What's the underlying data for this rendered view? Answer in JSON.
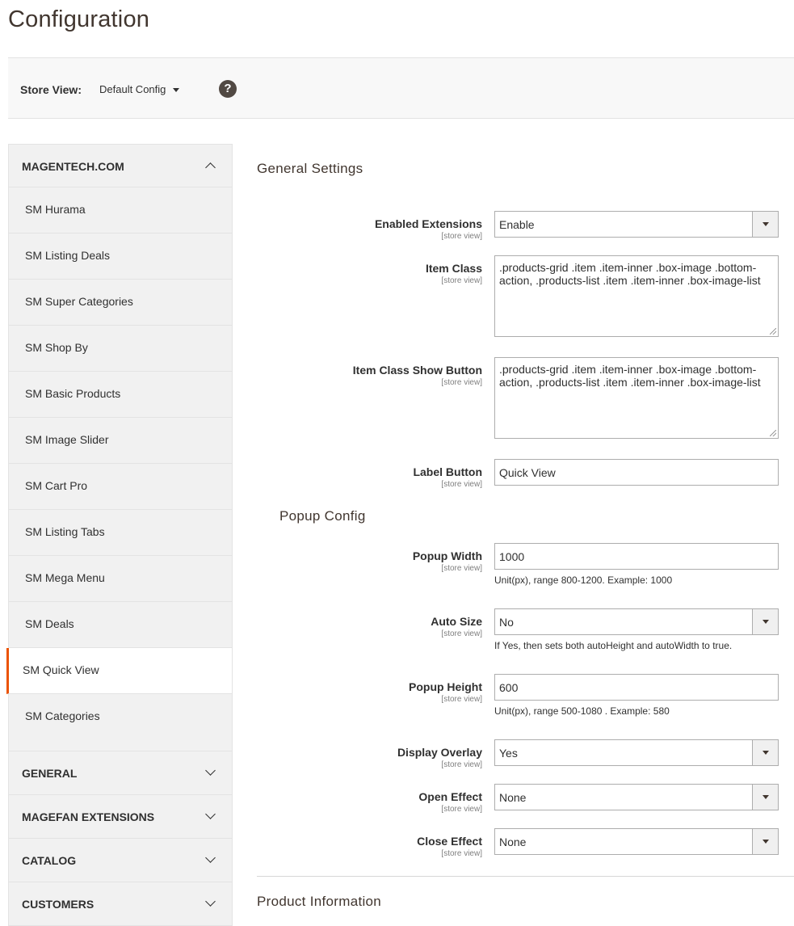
{
  "page_title": "Configuration",
  "store_switcher": {
    "label": "Store View:",
    "value": "Default Config",
    "help": "?"
  },
  "sidebar": {
    "top_section": {
      "title": "MAGENTECH.COM",
      "items": [
        {
          "label": "SM Hurama"
        },
        {
          "label": "SM Listing Deals"
        },
        {
          "label": "SM Super Categories"
        },
        {
          "label": "SM Shop By"
        },
        {
          "label": "SM Basic Products"
        },
        {
          "label": "SM Image Slider"
        },
        {
          "label": "SM Cart Pro"
        },
        {
          "label": "SM Listing Tabs"
        },
        {
          "label": "SM Mega Menu"
        },
        {
          "label": "SM Deals"
        },
        {
          "label": "SM Quick View",
          "active": true
        },
        {
          "label": "SM Categories"
        }
      ]
    },
    "collapsed_sections": [
      {
        "title": "GENERAL"
      },
      {
        "title": "MAGEFAN EXTENSIONS"
      },
      {
        "title": "CATALOG"
      },
      {
        "title": "CUSTOMERS"
      }
    ]
  },
  "main": {
    "general_settings_title": "General Settings",
    "popup_config_title": "Popup Config",
    "product_information_title": "Product Information",
    "scope_label": "[store view]",
    "fields": {
      "enabled_extensions": {
        "label": "Enabled Extensions",
        "value": "Enable"
      },
      "item_class": {
        "label": "Item Class",
        "value": ".products-grid .item .item-inner .box-image .bottom-action, .products-list .item .item-inner .box-image-list"
      },
      "item_class_show_button": {
        "label": "Item Class Show Button",
        "value": ".products-grid .item .item-inner .box-image .bottom-action, .products-list .item .item-inner .box-image-list"
      },
      "label_button": {
        "label": "Label Button",
        "value": "Quick View"
      },
      "popup_width": {
        "label": "Popup Width",
        "value": "1000",
        "note": "Unit(px), range 800-1200. Example: 1000"
      },
      "auto_size": {
        "label": "Auto Size",
        "value": "No",
        "note": "If Yes, then sets both autoHeight and autoWidth to true."
      },
      "popup_height": {
        "label": "Popup Height",
        "value": "600",
        "note": "Unit(px), range 500-1080 . Example: 580"
      },
      "display_overlay": {
        "label": "Display Overlay",
        "value": "Yes"
      },
      "open_effect": {
        "label": "Open Effect",
        "value": "None"
      },
      "close_effect": {
        "label": "Close Effect",
        "value": "None"
      }
    }
  },
  "colors": {
    "accent": "#eb5202",
    "title": "#41362f",
    "sidebar_bg": "#f1f1f1"
  }
}
